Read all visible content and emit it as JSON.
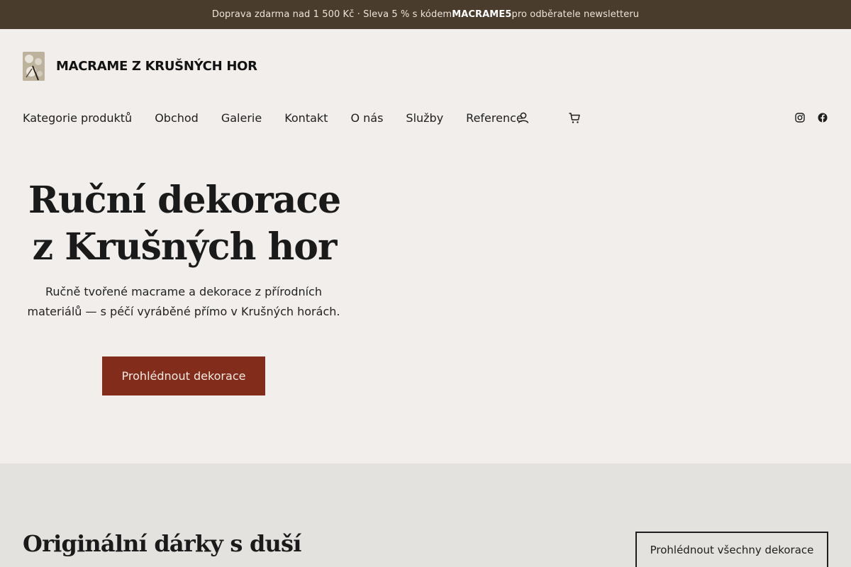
{
  "announcement": {
    "before": "Doprava zdarma nad 1 500 Kč · Sleva 5 % s kódem ",
    "code": "MACRAME5",
    "after": " pro odběratele newsletteru"
  },
  "site": {
    "title": "MACRAME Z KRUŠNÝCH HOR",
    "logo_icon": "macrame-logo-image"
  },
  "nav": {
    "items": [
      "Kategorie produktů",
      "Obchod",
      "Galerie",
      "Kontakt",
      "O nás",
      "Služby",
      "Reference"
    ],
    "account_icon": "user-icon",
    "cart_icon": "cart-icon"
  },
  "social": {
    "instagram_icon": "instagram-icon",
    "facebook_icon": "facebook-icon"
  },
  "hero": {
    "title": "Ruční dekorace z Krušných hor",
    "text": "Ručně tvořené macrame a dekorace z přírodních materiálů — s péčí vyráběné přímo v Krušných horách.",
    "button": "Prohlédnout dekorace"
  },
  "section2": {
    "title": "Originální dárky s duší",
    "button": "Prohlédnout všechny dekorace"
  },
  "colors": {
    "topbar": "#4a3c2c",
    "page_bg": "#f2eeeb",
    "accent_button": "#822d1c",
    "section2_bg": "#e4e2de"
  }
}
